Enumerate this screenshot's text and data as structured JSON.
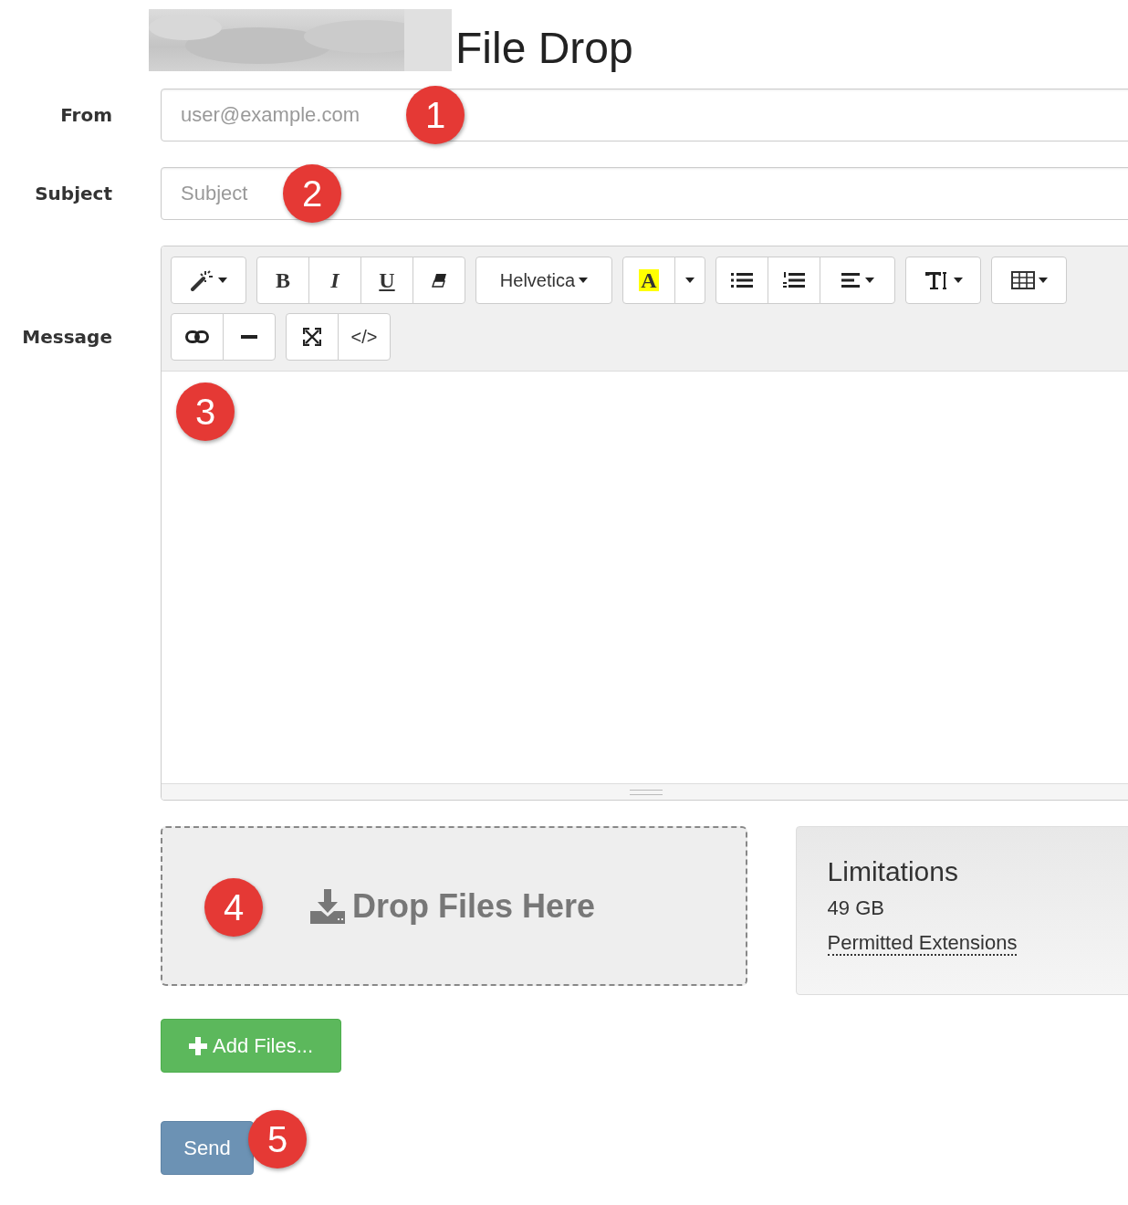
{
  "title": "File Drop",
  "fields": [
    {
      "label": "From",
      "placeholder": "user@example.com",
      "callout": "1"
    },
    {
      "label": "Subject",
      "placeholder": "Subject",
      "callout": "2"
    }
  ],
  "message": {
    "label": "Message",
    "callout": "3",
    "toolbar": [
      [
        {
          "buttons": [
            {
              "kind": "magic",
              "caret": true
            }
          ]
        },
        {
          "buttons": [
            {
              "kind": "bold",
              "text": "B"
            },
            {
              "kind": "italic",
              "text": "I"
            },
            {
              "kind": "underline",
              "text": "U"
            },
            {
              "kind": "eraser"
            }
          ]
        },
        {
          "buttons": [
            {
              "kind": "font",
              "text": "Helvetica",
              "caret": true
            }
          ]
        },
        {
          "buttons": [
            {
              "kind": "color",
              "text": "A"
            },
            {
              "kind": "caret"
            }
          ]
        },
        {
          "buttons": [
            {
              "kind": "ul"
            },
            {
              "kind": "ol"
            },
            {
              "kind": "align",
              "caret": true
            }
          ]
        },
        {
          "buttons": [
            {
              "kind": "fontsize",
              "caret": true
            }
          ]
        },
        {
          "buttons": [
            {
              "kind": "table",
              "caret": true
            }
          ]
        }
      ],
      [
        {
          "buttons": [
            {
              "kind": "link"
            },
            {
              "kind": "hr"
            }
          ]
        },
        {
          "buttons": [
            {
              "kind": "fullscreen"
            },
            {
              "kind": "code",
              "text": "</>"
            }
          ]
        }
      ]
    ]
  },
  "dropzone": {
    "text": "Drop Files Here",
    "callout": "4"
  },
  "limitations": {
    "title": "Limitations",
    "size": "49 GB",
    "extensions": "Permitted Extensions"
  },
  "add_button": {
    "text": "Add Files..."
  },
  "send_button": {
    "text": "Send",
    "callout": "5"
  }
}
